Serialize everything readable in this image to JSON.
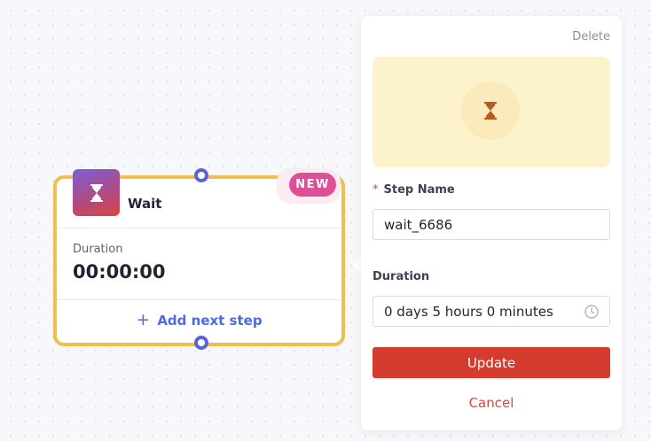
{
  "node": {
    "title": "Wait",
    "badge": "NEW",
    "duration_label": "Duration",
    "duration_value": "00:00:00",
    "add_next_label": "Add next step",
    "icon": "hourglass-icon"
  },
  "panel": {
    "delete_label": "Delete",
    "hero_icon": "hourglass-icon",
    "step_name": {
      "required_mark": "*",
      "label": "Step Name",
      "value": "wait_6686"
    },
    "duration": {
      "label": "Duration",
      "value": "0 days 5 hours 0 minutes",
      "icon": "clock-icon"
    },
    "update_label": "Update",
    "cancel_label": "Cancel"
  },
  "colors": {
    "node_border": "#f0be4a",
    "connector": "#5b63d8",
    "badge": "#de4f98",
    "link": "#4d6bdf",
    "hero_bg": "#fcf3cc",
    "hourglass": "#b85c1f",
    "primary": "#d43c2f"
  }
}
